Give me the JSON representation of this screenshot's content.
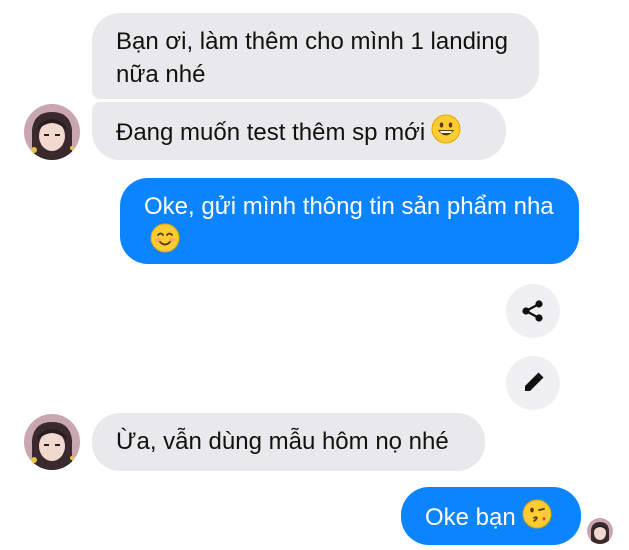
{
  "conversation": {
    "messages": [
      {
        "sender": "other",
        "text": "Bạn ơi, làm thêm cho mình 1 landing nữa nhé",
        "emoji": ""
      },
      {
        "sender": "other",
        "text": "Đang muốn test thêm sp mới",
        "emoji": "grinning-face"
      },
      {
        "sender": "me",
        "text": "Oke, gửi mình thông tin sản phẩm nha",
        "emoji": "smiling-face"
      },
      {
        "sender": "other",
        "text": "Ừa, vẫn dùng mẫu hôm nọ nhé",
        "emoji": ""
      },
      {
        "sender": "me",
        "text": "Oke bạn",
        "emoji": "face-blowing-kiss"
      }
    ]
  },
  "actions": {
    "share_icon": "share-icon",
    "edit_icon": "pencil-icon"
  },
  "colors": {
    "outgoing_bubble": "#0a84ff",
    "incoming_bubble": "#e9e9eb",
    "action_button": "#f0f0f2"
  }
}
